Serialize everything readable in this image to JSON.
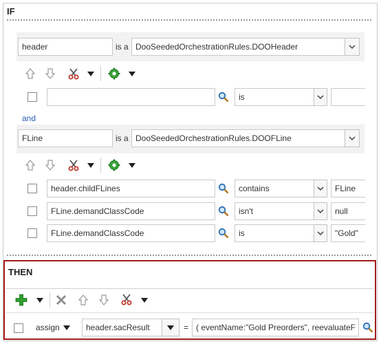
{
  "if_section": {
    "title": "IF",
    "block1": {
      "variable": "header",
      "is_a": "is a",
      "type": "DooSeededOrchestrationRules.DOOHeader",
      "condition": {
        "left": "",
        "operator": "is"
      }
    },
    "connector": "and",
    "block2": {
      "variable": "FLine",
      "is_a": "is a",
      "type": "DooSeededOrchestrationRules.DOOFLine",
      "conditions": [
        {
          "left": "header.childFLines",
          "operator": "contains",
          "right": "FLine"
        },
        {
          "left": "FLine.demandClassCode",
          "operator": "isn't",
          "right": "null"
        },
        {
          "left": "FLine.demandClassCode",
          "operator": "is",
          "right": "\"Gold\""
        }
      ]
    }
  },
  "then_section": {
    "title": "THEN",
    "action": {
      "verb": "assign",
      "target": "header.sacResult",
      "equals": "=",
      "value": "( eventName:\"Gold Preorders\", reevaluateF"
    }
  },
  "colors": {
    "then_border": "#a31b1b",
    "link": "#2a5db0",
    "add_icon": "#2e9e2e",
    "cut_icon": "#c0392b"
  }
}
